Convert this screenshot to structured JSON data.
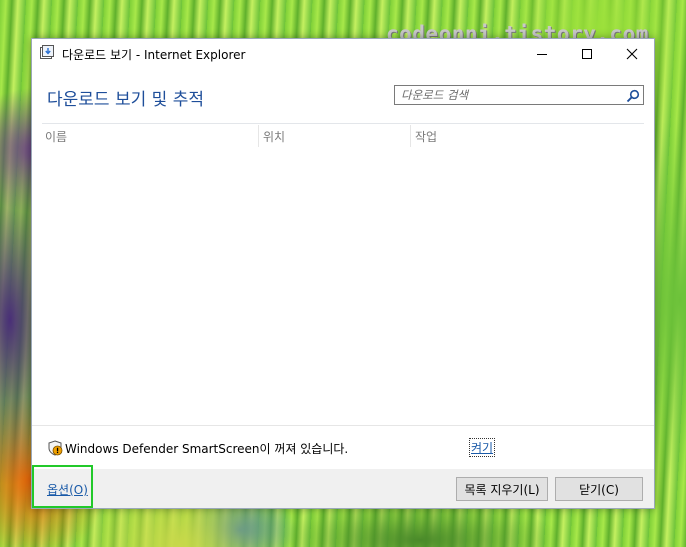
{
  "watermark": "codeonni.tistory.com",
  "window": {
    "title": "다운로드 보기 - Internet Explorer",
    "heading": "다운로드 보기 및 추적"
  },
  "search": {
    "placeholder": "다운로드 검색",
    "value": ""
  },
  "columns": [
    {
      "label": "이름"
    },
    {
      "label": "위치"
    },
    {
      "label": "작업"
    }
  ],
  "smartscreen": {
    "message": "Windows Defender SmartScreen이 꺼져 있습니다.",
    "action": "켜기"
  },
  "footer": {
    "options_label": "옵션(O)",
    "clear_list_label": "목록 지우기(L)",
    "close_label": "닫기(C)"
  },
  "colors": {
    "heading": "#1e4e9a",
    "link": "#1a5aa8",
    "footer_bg": "#f0f0f0",
    "focus_highlight": "#22c92a"
  },
  "icons": [
    "downloads-app-icon",
    "minimize-icon",
    "maximize-icon",
    "close-icon",
    "search-icon",
    "warning-shield-icon"
  ]
}
